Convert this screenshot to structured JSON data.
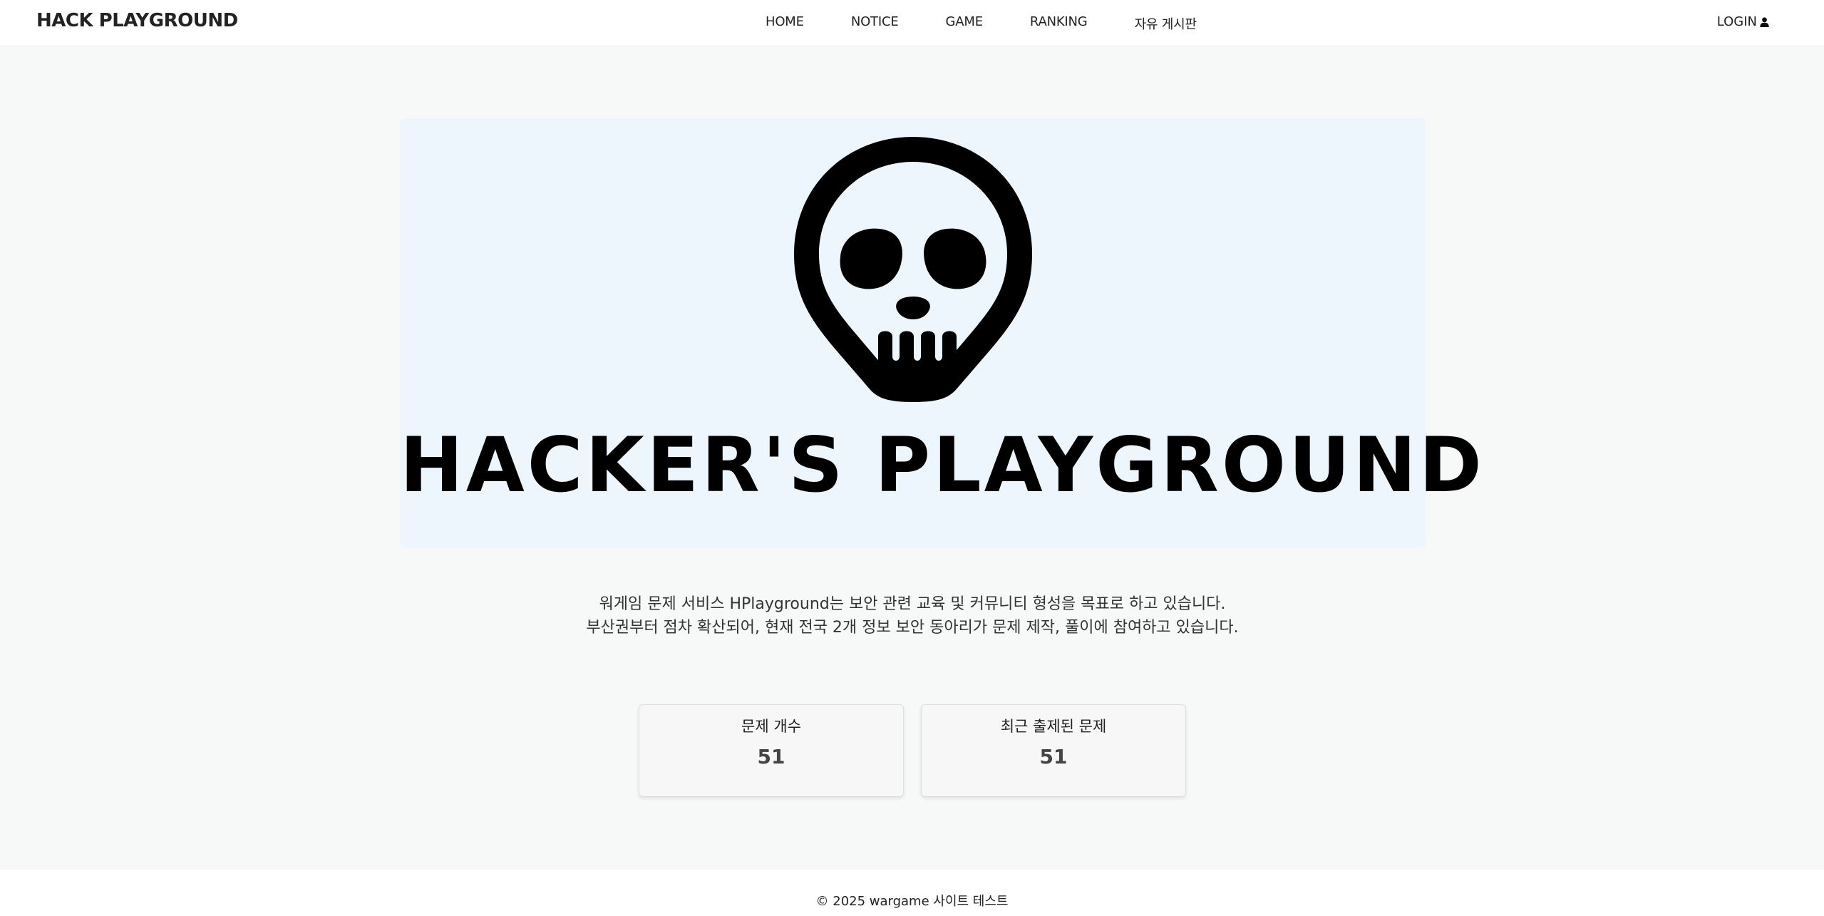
{
  "header": {
    "brand": "HACK PLAYGROUND",
    "nav": [
      {
        "label": "HOME"
      },
      {
        "label": "NOTICE"
      },
      {
        "label": "GAME"
      },
      {
        "label": "RANKING"
      },
      {
        "label": "자유 게시판"
      }
    ],
    "login_label": "LOGIN",
    "login_icon": "user-icon"
  },
  "hero": {
    "logo_icon": "skull-icon",
    "logo_text": "HACKER'S PLAYGROUND",
    "background_color": "#edf5fd"
  },
  "description": {
    "line1": "워게임 문제 서비스 HPlayground는 보안 관련 교육 및 커뮤니티 형성을 목표로 하고 있습니다.",
    "line2": "부산권부터 점차 확산되어, 현재 전국 2개 정보 보안 동아리가 문제 제작, 풀이에 참여하고 있습니다."
  },
  "stats": [
    {
      "label": "문제 개수",
      "value": "51"
    },
    {
      "label": "최근 출제된 문제",
      "value": "51"
    }
  ],
  "footer": {
    "copyright": "© 2025 wargame 사이트 테스트"
  }
}
